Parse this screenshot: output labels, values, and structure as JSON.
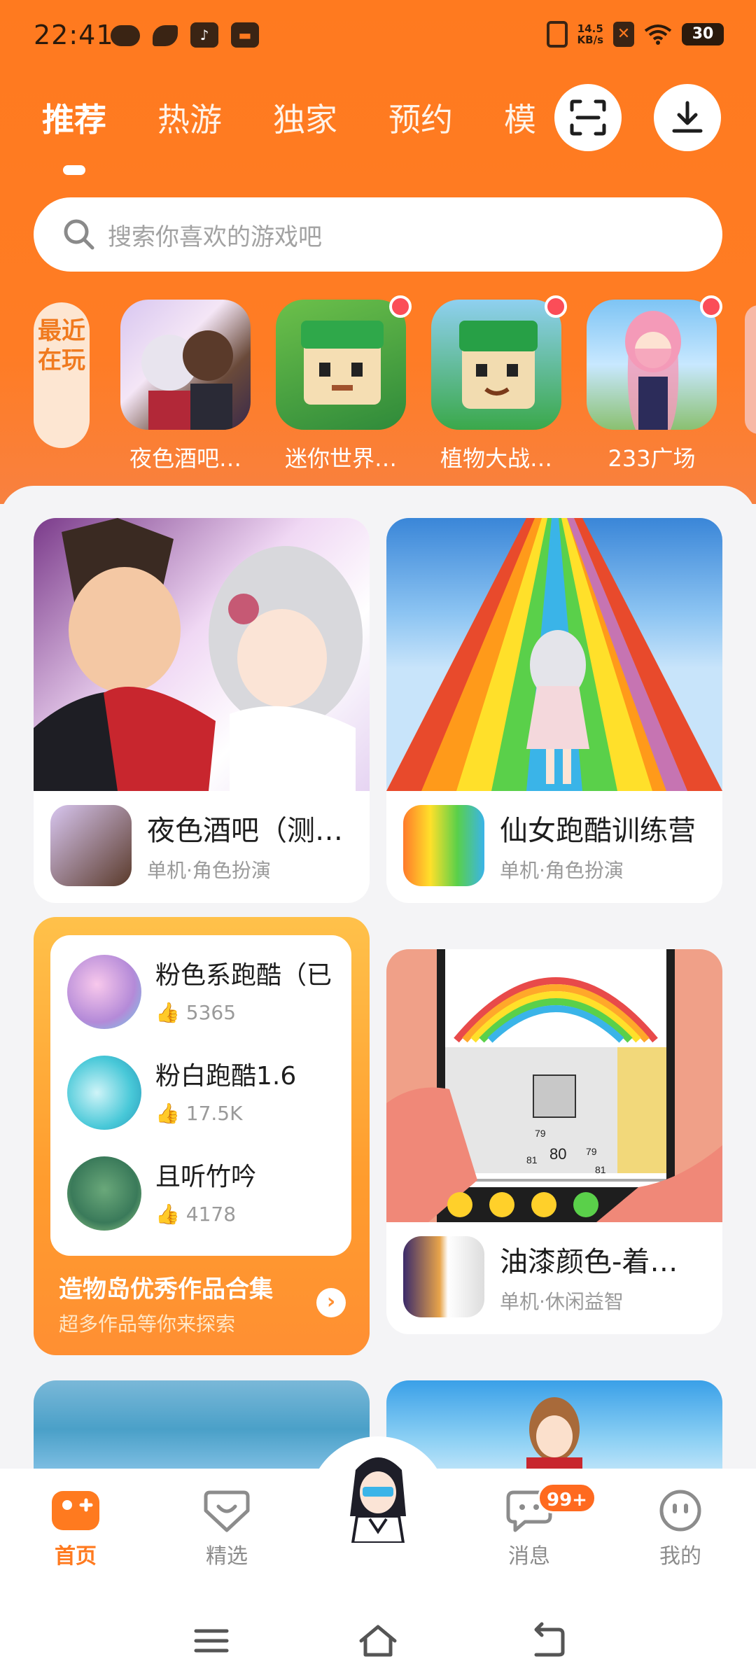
{
  "status_bar": {
    "time": "22:41",
    "speed_value": "14.5",
    "speed_unit": "KB/s",
    "battery": "30"
  },
  "tabs": [
    {
      "label": "推荐",
      "active": true
    },
    {
      "label": "热游",
      "active": false
    },
    {
      "label": "独家",
      "active": false
    },
    {
      "label": "预约",
      "active": false
    },
    {
      "label": "模",
      "active": false
    }
  ],
  "header_actions": {
    "scan_icon": "scan-icon",
    "download_icon": "download-icon"
  },
  "search": {
    "placeholder": "搜索你喜欢的游戏吧"
  },
  "recent": {
    "tag": "最近在玩",
    "games": [
      {
        "name": "夜色酒吧…",
        "has_dot": false
      },
      {
        "name": "迷你世界…",
        "has_dot": true
      },
      {
        "name": "植物大战…",
        "has_dot": true
      },
      {
        "name": "233广场",
        "has_dot": true
      }
    ]
  },
  "cards": [
    {
      "title": "夜色酒吧（测…",
      "sub": "单机·角色扮演"
    },
    {
      "title": "仙女跑酷训练营",
      "sub": "单机·角色扮演"
    },
    {
      "title": "油漆颜色-着…",
      "sub": "单机·休闲益智"
    }
  ],
  "collection": {
    "items": [
      {
        "title": "粉色系跑酷（已",
        "likes": "5365"
      },
      {
        "title": "粉白跑酷1.6",
        "likes": "17.5K"
      },
      {
        "title": "且听竹吟",
        "likes": "4178"
      }
    ],
    "title": "造物岛优秀作品合集",
    "subtitle": "超多作品等你来探索"
  },
  "coloring_numbers": [
    "79",
    "80",
    "81",
    "79",
    "81"
  ],
  "bottom_nav": [
    {
      "label": "首页",
      "active": true
    },
    {
      "label": "精选",
      "active": false
    },
    {
      "label": "消息",
      "active": false
    },
    {
      "label": "我的",
      "active": false
    }
  ],
  "message_badge": "99+",
  "colors": {
    "accent": "#ff7a1f",
    "badge": "#ff6a1f",
    "dot": "#fb4d58"
  }
}
